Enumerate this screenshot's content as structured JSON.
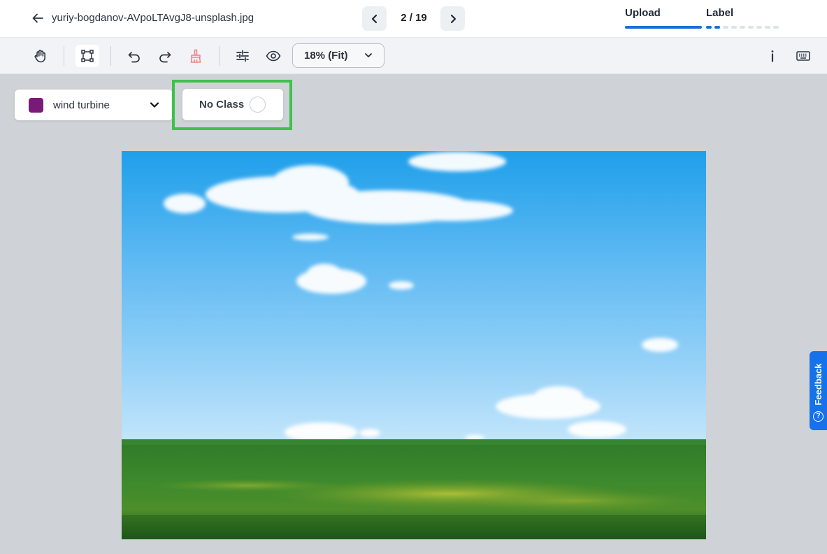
{
  "header": {
    "back_icon": "arrow-left-icon",
    "filename": "yuriy-bogdanov-AVpoLTAvgJ8-unsplash.jpg",
    "page_indicator": "2 / 19",
    "steps": [
      {
        "label": "Upload",
        "progress": 1.0
      },
      {
        "label": "Label",
        "progress": 0.2
      }
    ]
  },
  "toolbar": {
    "tools": [
      "hand-pan-icon",
      "bounding-box-icon",
      "undo-icon",
      "redo-icon",
      "clear-brush-icon",
      "adjustments-icon",
      "visibility-eye-icon",
      "info-icon",
      "keyboard-shortcuts-icon"
    ],
    "zoom_label": "18% (Fit)"
  },
  "class_selector": {
    "selected_class": "wind turbine",
    "class_color": "#7a1a78"
  },
  "no_class": {
    "label": "No Class",
    "checked": false,
    "highlight_color": "#3ec24b"
  },
  "feedback": {
    "label": "Feedback"
  },
  "colors": {
    "accent": "#1a6fd6",
    "feedback_tab": "#1572e8"
  }
}
